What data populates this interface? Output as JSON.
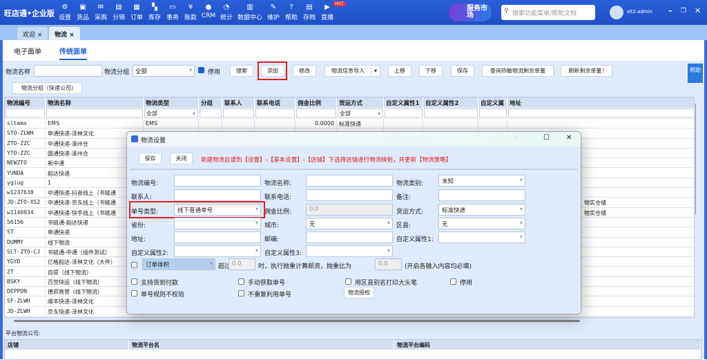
{
  "app": {
    "logo": "旺店通•企业版",
    "search_placeholder": "搜索功能菜单/帮助文档",
    "user": "slt2:admin",
    "service_badge": "服务市场",
    "service_new": "NEW",
    "hot": "HOT"
  },
  "nav": [
    {
      "label": "设置",
      "icon": "⚙"
    },
    {
      "label": "货品",
      "icon": "▣"
    },
    {
      "label": "采购",
      "icon": "✉"
    },
    {
      "label": "分销",
      "icon": "▤"
    },
    {
      "label": "订单",
      "icon": "▦"
    },
    {
      "label": "库存",
      "icon": "▚"
    },
    {
      "label": "事务",
      "icon": "▭"
    },
    {
      "label": "账款",
      "icon": "¥"
    },
    {
      "label": "CRM",
      "icon": "●"
    },
    {
      "label": "统计",
      "icon": "◔"
    },
    {
      "label": "数据中心",
      "icon": "▥"
    },
    {
      "label": "维护",
      "icon": "✎"
    },
    {
      "label": "帮助",
      "icon": "?"
    },
    {
      "label": "存档",
      "icon": "▤"
    },
    {
      "label": "直播",
      "icon": "▶"
    }
  ],
  "tabs": [
    {
      "label": "欢迎"
    },
    {
      "label": "物流"
    }
  ],
  "subtabs": [
    {
      "label": "电子面单"
    },
    {
      "label": "传统面单"
    }
  ],
  "toolbar": {
    "name_label": "物流名称",
    "group_label": "物流分组",
    "group_value": "全部",
    "disabled_label": "停用",
    "search": "搜索",
    "add": "添加",
    "edit": "修改",
    "import": "物流信息导入",
    "up": "上移",
    "down": "下移",
    "save": "保存",
    "query_hot": "查询热敏物流剩余单量",
    "refresh_remaining": "刷新剩余单量",
    "question": "?",
    "group_btn": "物流分组（快递公司)",
    "help": "帮助"
  },
  "grid": {
    "columns": [
      "物流编号",
      "物流名称",
      "物流类型",
      "分组",
      "联系人",
      "联系电话",
      "佣金比例",
      "货运方式",
      "自定义属性1",
      "自定义属性2",
      "自定义属",
      "地址"
    ],
    "filter": {
      "type": "全部",
      "ship": "全部"
    },
    "rows": [
      [
        "sltems",
        "EMS",
        "EMS",
        "",
        "",
        "",
        "0.0000",
        "标准快递",
        "",
        "",
        "",
        ""
      ],
      [
        "STO-ZLWH",
        "申通快递-泽林文化",
        "",
        "",
        "",
        "",
        "",
        "",
        "",
        "",
        "",
        ""
      ],
      [
        "ZTO-ZZC",
        "中通快递-涿州仓",
        "",
        "",
        "",
        "",
        "",
        "",
        "",
        "",
        "",
        ""
      ],
      [
        "YTO-ZZC",
        "圆通快递-涿州仓",
        "",
        "",
        "",
        "",
        "",
        "",
        "",
        "",
        "",
        ""
      ],
      [
        "NEWZTO",
        "新中通",
        "",
        "",
        "",
        "",
        "",
        "",
        "",
        "",
        "",
        ""
      ],
      [
        "YUNDA",
        "韵达快递",
        "",
        "",
        "",
        "",
        "",
        "",
        "",
        "",
        "",
        ""
      ],
      [
        "ygiug",
        "1",
        "",
        "",
        "",
        "",
        "",
        "",
        "",
        "",
        "",
        ""
      ],
      [
        "w1237638",
        "中通快递-抖音线上（书链通",
        "",
        "",
        "",
        "",
        "",
        "",
        "",
        "",
        "",
        ""
      ],
      [
        "JD-ZTO-XS2",
        "中通快递-京东线上（书链通",
        "",
        "",
        "",
        "",
        "",
        "",
        "",
        "",
        "",
        "物实仓储"
      ],
      [
        "w1140934",
        "中通快递-快手线上（书链通",
        "",
        "",
        "",
        "",
        "",
        "",
        "",
        "",
        "",
        "物实仓储"
      ],
      [
        "56156",
        "书链通-韵达快递",
        "",
        "",
        "",
        "",
        "",
        "",
        "",
        "",
        "",
        ""
      ],
      [
        "ST",
        "申通快递",
        "",
        "",
        "",
        "",
        "",
        "",
        "",
        "",
        "",
        ""
      ],
      [
        "DUMMY",
        "线下物流",
        "",
        "",
        "",
        "",
        "",
        "",
        "",
        "",
        "",
        ""
      ],
      [
        "SLT-ZTO-CJ",
        "书链通-中通（插件测试）",
        "",
        "",
        "",
        "",
        "",
        "",
        "",
        "",
        "",
        ""
      ],
      [
        "YGYD",
        "亿格韵达-泽林文化（大件）",
        "",
        "",
        "",
        "",
        "",
        "",
        "",
        "",
        "",
        ""
      ],
      [
        "ZT",
        "自提（线下物流）",
        "",
        "",
        "",
        "",
        "",
        "",
        "",
        "",
        "",
        ""
      ],
      [
        "BSKY",
        "百世快运（线下物流）",
        "",
        "",
        "",
        "",
        "",
        "",
        "",
        "",
        "",
        ""
      ],
      [
        "DEPPON",
        "德邦直营（线下物流）",
        "",
        "",
        "",
        "",
        "",
        "",
        "",
        "",
        "",
        ""
      ],
      [
        "SF-ZLWH",
        "顺丰快递-泽林文化",
        "",
        "",
        "",
        "",
        "",
        "",
        "",
        "",
        "",
        ""
      ],
      [
        "JD-ZLWH",
        "京东快递-泽林文化",
        "",
        "",
        "",
        "",
        "",
        "",
        "",
        "",
        "",
        ""
      ]
    ]
  },
  "platform": {
    "label": "平台物流公司:",
    "columns": [
      "店铺",
      "物流平台名",
      "物流平台编码"
    ]
  },
  "dialog": {
    "title": "物流设置",
    "save": "保存",
    "close": "关闭",
    "notice": "新建物流后请到【设置】-【基本设置】-【店铺】下选择店铺进行物流映射，并更新【物流策略】",
    "code": "物流编号:",
    "name": "物流名称:",
    "category": "物流类别:",
    "category_value": "未知",
    "contact": "联系人:",
    "phone": "联系电话:",
    "remark": "备注:",
    "no_type": "单号类型:",
    "no_type_value": "线下普通单号",
    "commission": "佣金比例:",
    "commission_value": "0.0",
    "ship": "货运方式:",
    "ship_value": "标准快递",
    "province": "省份:",
    "city": "城市:",
    "city_value": "无",
    "district": "区县:",
    "district_value": "无",
    "address": "地址:",
    "zip": "邮编:",
    "attr1": "自定义属性1:",
    "attr2": "自定义属性2:",
    "attr3": "自定义属性3:",
    "volume_select": "订单体积",
    "exceed": "超过",
    "exceed_value": "0.0",
    "calc_text": "时，执行抛重计算邮资，抛重比为",
    "ratio_value": "0.0",
    "required_note": "(开启各输入内容均必填)",
    "cod": "支持货到付款",
    "manual": "手动获取单号",
    "alias": "用区县别名打印大头笔",
    "disable": "停用",
    "no_check": "单号规则不校验",
    "no_reuse": "不重复利用单号",
    "auth": "物流授权"
  }
}
